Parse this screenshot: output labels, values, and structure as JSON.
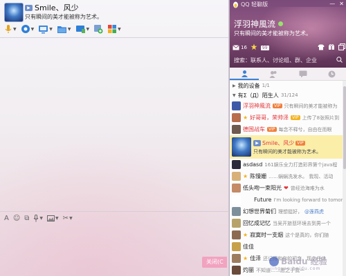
{
  "chat": {
    "contact_name": "Smile、风少",
    "signature": "只有瞬间的美才能被称为艺术。",
    "toolbar_icons": [
      "microphone-icon",
      "video-icon",
      "screen-share-icon",
      "folder-icon",
      "remote-desktop-icon",
      "add-app-icon",
      "apps-grid-icon"
    ],
    "input_icons": [
      "font-icon",
      "emoji-icon",
      "shake-icon",
      "voice-message-icon",
      "image-icon",
      "screenshot-scissors-icon"
    ],
    "close_label": "关闭(C"
  },
  "qq": {
    "app_title": "QQ 轻聊版",
    "nickname": "浮羽神風流",
    "signature": "只有瞬间的美才能被称为艺术。",
    "mail_count": "16",
    "badge_99": "99",
    "search_placeholder": "搜索：联系人、讨论组、群、企业",
    "tabs": [
      "contacts-tab",
      "friends-tab",
      "group-chat-tab",
      "recent-tab"
    ],
    "groups": [
      {
        "name": "我的设备",
        "count": "1/1"
      },
      {
        "name": "有Σ（Д）陌生人",
        "count": "31/124"
      }
    ],
    "contacts": [
      {
        "name": "浮羽神風流",
        "tag": "VIP",
        "sig": "只有瞬间的美才能被称为",
        "red": true,
        "av": "#3e5aa7"
      },
      {
        "name": "好哥哥，荣帅泽",
        "tag": "VIP",
        "sig": "上传了8张照片到",
        "red": true,
        "star": true,
        "av": "#b86d4d"
      },
      {
        "name": "德国战车",
        "tag": "VIP",
        "sig": "每念不释兮，自由在而眼",
        "red": true,
        "av": "#6f5a50"
      }
    ],
    "selected": {
      "name": "Smile、风少",
      "tag": "VIP",
      "sig": "只有瞬间的美才能被称为艺术。"
    },
    "contacts_more": [
      {
        "name": "asdasd",
        "sig": "161娱乐全力打造彩界第个java程",
        "av": "#2b2b3b"
      },
      {
        "name": "陈慢姗",
        "sig": "……蜗蜗洗发水。  我现、活动",
        "star": true,
        "av": "#d7b07a"
      },
      {
        "name": "低头吻一束阳光",
        "sig": "曾经沧海难为水",
        "heart": true,
        "av": "#c58a68"
      },
      {
        "name": "Future",
        "sig": "I'm looking forward to tomorrow",
        "av": "#ffffff"
      },
      {
        "name": "幻想世界菊们",
        "sig": "理想挺好，",
        "sig_blue": "@莲燕虎",
        "av": "#7e8f9c"
      },
      {
        "name": "回忆成记忆",
        "sig": "当吴开旅悲环境去到男一个",
        "av": "#b7a36a"
      },
      {
        "name": "寂寞时一支烟",
        "sig": "这个是真的，你们随",
        "star": true,
        "av": "#8c6a52"
      },
      {
        "name": "佳佳",
        "sig": "",
        "av": "#c7a04a"
      },
      {
        "name": "佳泽",
        "sig": "还记得和你的初恋，现主任佳",
        "star": true,
        "av": "#9e7d5e"
      },
      {
        "name": "灼丽",
        "sig": "不知道……愿之于我一",
        "av": "#6a4a3a"
      }
    ]
  },
  "watermark": {
    "text": "Baidu 经验",
    "sub": "jingyan.baidu.com"
  }
}
